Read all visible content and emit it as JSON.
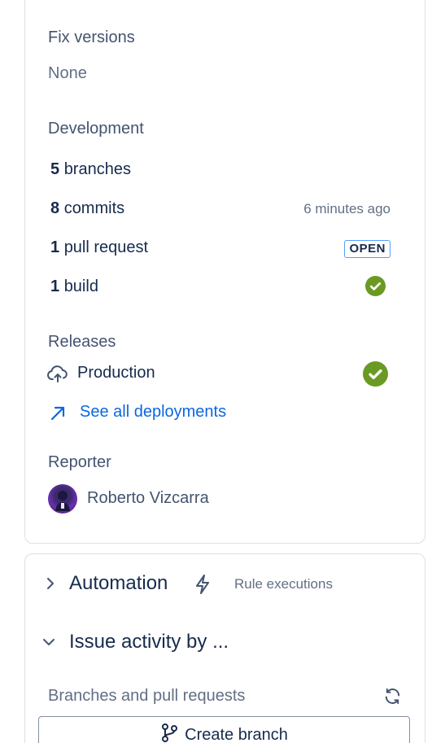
{
  "fix_versions": {
    "label": "Fix versions",
    "value": "None"
  },
  "development": {
    "label": "Development",
    "branches": {
      "count": "5",
      "text": "branches"
    },
    "commits": {
      "count": "8",
      "text": "commits",
      "time": "6 minutes ago"
    },
    "pull_requests": {
      "count": "1",
      "text": "pull request",
      "status": "OPEN"
    },
    "builds": {
      "count": "1",
      "text": "build"
    }
  },
  "releases": {
    "label": "Releases",
    "environment": "Production",
    "see_all": "See all deployments"
  },
  "reporter": {
    "label": "Reporter",
    "name": "Roberto Vizcarra"
  },
  "automation": {
    "title": "Automation",
    "rule_executions": "Rule executions"
  },
  "issue_activity": {
    "title": "Issue activity by ...",
    "branches_prs_label": "Branches and pull requests",
    "create_branch": "Create branch"
  },
  "colors": {
    "success": "#6a9a23",
    "link": "#0c66e4",
    "lozenge_border": "#579dff"
  }
}
